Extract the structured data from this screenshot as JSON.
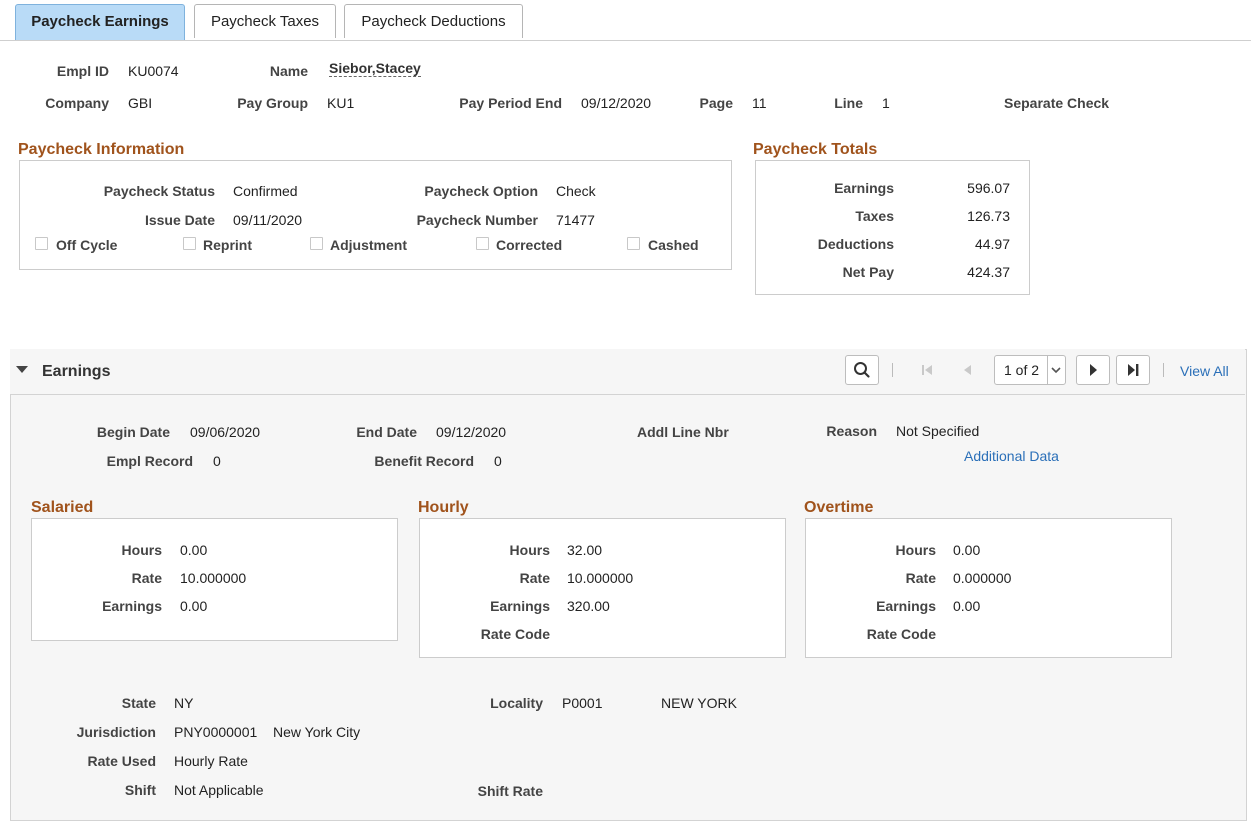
{
  "tabs": [
    {
      "label": "Paycheck Earnings",
      "active": true
    },
    {
      "label": "Paycheck Taxes",
      "active": false
    },
    {
      "label": "Paycheck Deductions",
      "active": false
    }
  ],
  "header": {
    "empl_id_label": "Empl ID",
    "empl_id": "KU0074",
    "name_label": "Name",
    "name": "Siebor,Stacey",
    "company_label": "Company",
    "company": "GBI",
    "pay_group_label": "Pay Group",
    "pay_group": "KU1",
    "pay_period_end_label": "Pay Period End",
    "pay_period_end": "09/12/2020",
    "page_label": "Page",
    "page": "11",
    "line_label": "Line",
    "line": "1",
    "separate_check_label": "Separate Check"
  },
  "paycheck_info": {
    "title": "Paycheck Information",
    "status_label": "Paycheck Status",
    "status": "Confirmed",
    "option_label": "Paycheck Option",
    "option": "Check",
    "issue_date_label": "Issue Date",
    "issue_date": "09/11/2020",
    "number_label": "Paycheck Number",
    "number": "71477",
    "checkboxes": [
      {
        "label": "Off Cycle",
        "checked": false
      },
      {
        "label": "Reprint",
        "checked": false
      },
      {
        "label": "Adjustment",
        "checked": false
      },
      {
        "label": "Corrected",
        "checked": false
      },
      {
        "label": "Cashed",
        "checked": false
      }
    ]
  },
  "paycheck_totals": {
    "title": "Paycheck Totals",
    "rows": [
      {
        "label": "Earnings",
        "value": "596.07"
      },
      {
        "label": "Taxes",
        "value": "126.73"
      },
      {
        "label": "Deductions",
        "value": "44.97"
      },
      {
        "label": "Net Pay",
        "value": "424.37"
      }
    ]
  },
  "earnings": {
    "title": "Earnings",
    "pager": "1 of 2",
    "view_all": "View All",
    "begin_date_label": "Begin Date",
    "begin_date": "09/06/2020",
    "end_date_label": "End Date",
    "end_date": "09/12/2020",
    "addl_line_label": "Addl Line Nbr",
    "reason_label": "Reason",
    "reason": "Not Specified",
    "additional_data": "Additional Data",
    "empl_record_label": "Empl Record",
    "empl_record": "0",
    "benefit_record_label": "Benefit Record",
    "benefit_record": "0",
    "salaried": {
      "title": "Salaried",
      "hours_label": "Hours",
      "hours": "0.00",
      "rate_label": "Rate",
      "rate": "10.000000",
      "earnings_label": "Earnings",
      "earnings": "0.00"
    },
    "hourly": {
      "title": "Hourly",
      "hours_label": "Hours",
      "hours": "32.00",
      "rate_label": "Rate",
      "rate": "10.000000",
      "earnings_label": "Earnings",
      "earnings": "320.00",
      "rate_code_label": "Rate Code"
    },
    "overtime": {
      "title": "Overtime",
      "hours_label": "Hours",
      "hours": "0.00",
      "rate_label": "Rate",
      "rate": "0.000000",
      "earnings_label": "Earnings",
      "earnings": "0.00",
      "rate_code_label": "Rate Code"
    },
    "state_label": "State",
    "state": "NY",
    "locality_label": "Locality",
    "locality": "P0001",
    "locality_name": "NEW YORK",
    "jurisdiction_label": "Jurisdiction",
    "jurisdiction": "PNY0000001",
    "jurisdiction_name": "New York City",
    "rate_used_label": "Rate Used",
    "rate_used": "Hourly Rate",
    "shift_label": "Shift",
    "shift": "Not Applicable",
    "shift_rate_label": "Shift Rate"
  }
}
